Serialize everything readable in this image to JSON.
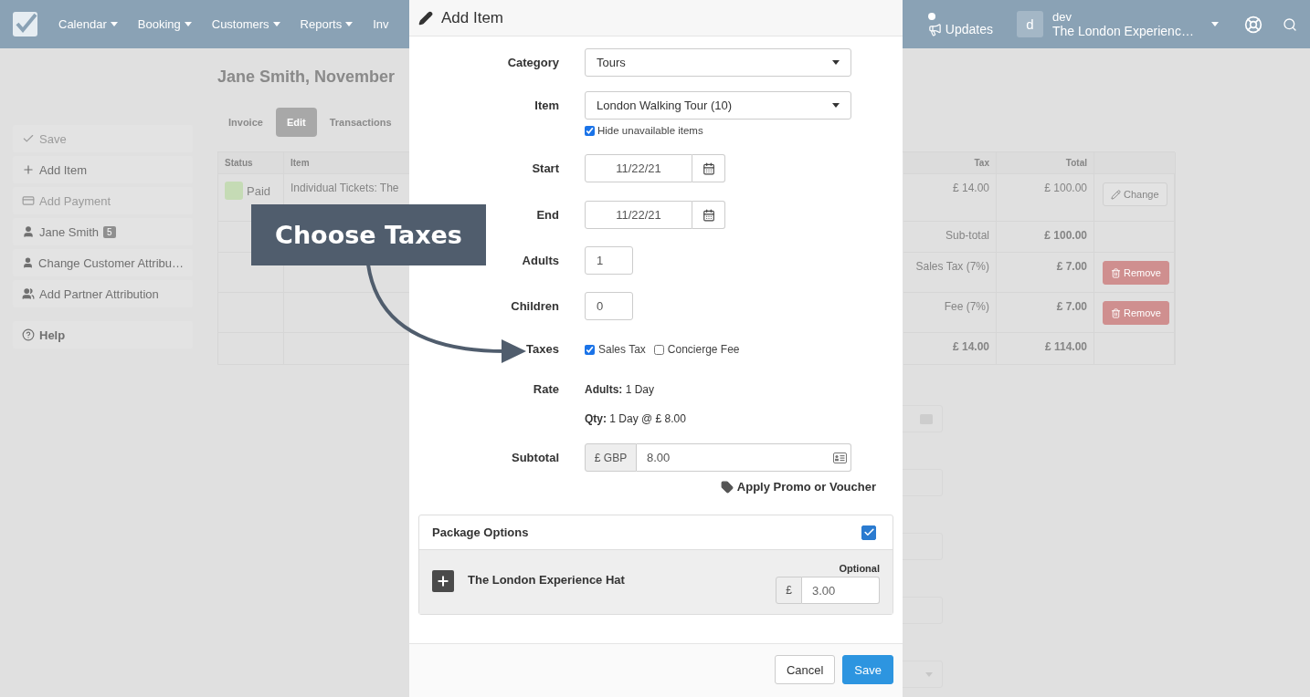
{
  "navbar": {
    "menus": [
      "Calendar",
      "Booking",
      "Customers",
      "Reports",
      "Inv"
    ],
    "updates": "Updates",
    "avatar": "d",
    "user": "dev",
    "company": "The London Experienc…"
  },
  "sidebar": [
    {
      "kind": "save",
      "label": "Save",
      "disabled": true
    },
    {
      "kind": "add",
      "label": "Add Item",
      "disabled": false
    },
    {
      "kind": "payment",
      "label": "Add Payment",
      "disabled": true
    },
    {
      "kind": "person",
      "label": "Jane Smith",
      "badge": "5",
      "disabled": false
    },
    {
      "kind": "person",
      "label": "Change Customer Attribu…",
      "disabled": false
    },
    {
      "kind": "people",
      "label": "Add Partner Attribution",
      "disabled": false
    },
    {
      "kind": "help",
      "label": "Help",
      "disabled": false
    }
  ],
  "page": {
    "title": "Jane Smith, November",
    "tabs": [
      {
        "label": "Invoice",
        "selected": false
      },
      {
        "label": "Edit",
        "selected": true
      },
      {
        "label": "Transactions",
        "selected": false
      }
    ]
  },
  "table": {
    "columns": [
      "Status",
      "Item",
      "Tax",
      "Total"
    ],
    "rows": [
      {
        "kind": "item",
        "status": "Paid",
        "item": "Individual Tickets: The",
        "tax": "£ 14.00",
        "total": "£ 100.00",
        "action": "Change"
      },
      {
        "kind": "subtotal",
        "tax": "Sub-total",
        "total": "£ 100.00"
      },
      {
        "kind": "tax",
        "tax": "Sales Tax (7%)",
        "total": "£ 7.00",
        "action": "Remove"
      },
      {
        "kind": "tax",
        "tax": "Fee (7%)",
        "total": "£ 7.00",
        "action": "Remove"
      },
      {
        "kind": "total",
        "tax": "£ 14.00",
        "total": "£ 114.00"
      }
    ]
  },
  "modal": {
    "title": "Add Item",
    "fields": [
      {
        "kind": "select",
        "label": "Category",
        "value": "Tours"
      },
      {
        "kind": "select",
        "label": "Item",
        "value": "London Walking Tour (10)",
        "checkbox": {
          "label": "Hide unavailable items",
          "checked": true
        }
      },
      {
        "kind": "date",
        "label": "Start",
        "value": "11/22/21"
      },
      {
        "kind": "date",
        "label": "End",
        "value": "11/22/21"
      },
      {
        "kind": "number",
        "label": "Adults",
        "value": "1"
      },
      {
        "kind": "number",
        "label": "Children",
        "value": "0"
      },
      {
        "kind": "checkboxes",
        "label": "Taxes",
        "options": [
          {
            "label": "Sales Tax",
            "checked": true
          },
          {
            "label": "Concierge Fee",
            "checked": false
          }
        ]
      },
      {
        "kind": "rate",
        "label": "Rate",
        "lines": [
          "**Adults:** 1 Day",
          "**Qty:** 1 Day @ £ 8.00"
        ]
      },
      {
        "kind": "money",
        "label": "Subtotal",
        "addon": "£ GBP",
        "value": "8.00",
        "link": "Apply Promo or Voucher"
      }
    ],
    "package": {
      "title": "Package Options",
      "checked": true,
      "items": [
        {
          "name": "The London Experience Hat",
          "note": "Optional",
          "currency": "£",
          "value": "3.00"
        }
      ]
    },
    "buttons": [
      {
        "kind": "default",
        "label": "Cancel"
      },
      {
        "kind": "primary",
        "label": "Save"
      }
    ]
  },
  "callout": {
    "text": "Choose Taxes"
  }
}
